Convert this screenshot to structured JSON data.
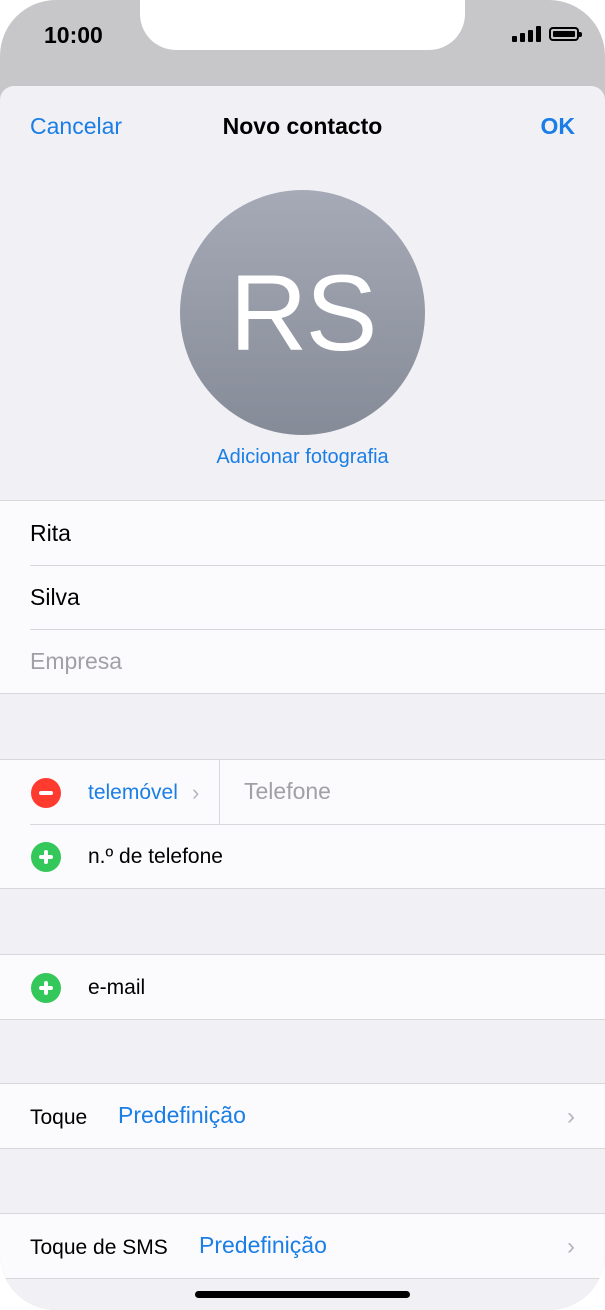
{
  "status_bar": {
    "time": "10:00"
  },
  "nav": {
    "cancel": "Cancelar",
    "title": "Novo contacto",
    "ok": "OK"
  },
  "avatar": {
    "initials": "RS",
    "add_photo": "Adicionar fotografia"
  },
  "name_fields": {
    "first_name": "Rita",
    "last_name": "Silva",
    "company_placeholder": "Empresa"
  },
  "phone_section": {
    "label": "telemóvel",
    "phone_placeholder": "Telefone",
    "add_phone": "n.º de telefone"
  },
  "email_section": {
    "add_email": "e-mail"
  },
  "ringtone": {
    "label": "Toque",
    "value": "Predefinição"
  },
  "text_tone": {
    "label": "Toque de SMS",
    "value": "Predefinição"
  },
  "colors": {
    "accent": "#1a7ee6",
    "delete": "#ff3b30",
    "add": "#34c759"
  }
}
